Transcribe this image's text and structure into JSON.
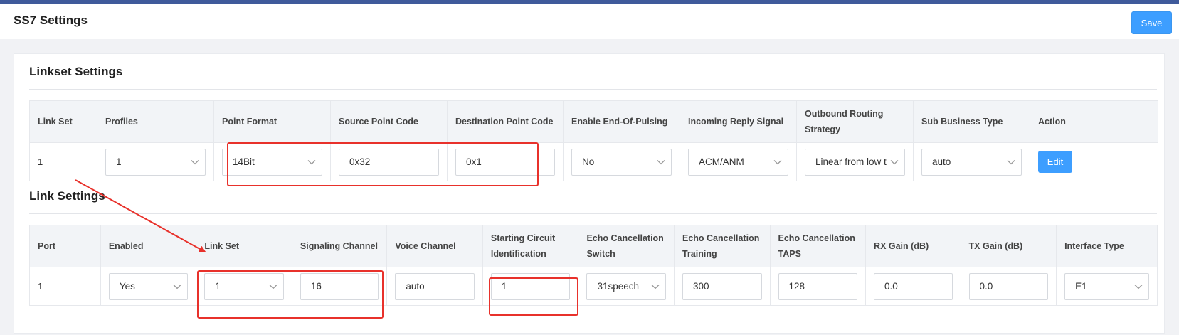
{
  "header": {
    "title": "SS7 Settings",
    "save_label": "Save"
  },
  "linkset": {
    "title": "Linkset Settings",
    "columns": [
      "Link Set",
      "Profiles",
      "Point Format",
      "Source Point Code",
      "Destination Point Code",
      "Enable End-Of-Pulsing",
      "Incoming Reply Signal",
      "Outbound Routing Strategy",
      "Sub Business Type",
      "Action"
    ],
    "row": {
      "link_set": "1",
      "profiles": "1",
      "point_format": "14Bit",
      "source_point_code": "0x32",
      "destination_point_code": "0x1",
      "enable_eop": "No",
      "incoming_reply_signal": "ACM/ANM",
      "outbound_routing_strategy": "Linear from low to",
      "sub_business_type": "auto",
      "edit_label": "Edit"
    }
  },
  "link": {
    "title": "Link Settings",
    "columns": [
      "Port",
      "Enabled",
      "Link Set",
      "Signaling Channel",
      "Voice Channel",
      "Starting Circuit Identification",
      "Echo Cancellation Switch",
      "Echo Cancellation Training",
      "Echo Cancellation TAPS",
      "RX Gain (dB)",
      "TX Gain (dB)",
      "Interface Type"
    ],
    "row": {
      "port": "1",
      "enabled": "Yes",
      "link_set": "1",
      "signaling_channel": "16",
      "voice_channel": "auto",
      "starting_cic": "1",
      "echo_switch": "31speech",
      "echo_training": "300",
      "echo_taps": "128",
      "rx_gain": "0.0",
      "tx_gain": "0.0",
      "interface_type": "E1"
    }
  },
  "colors": {
    "accent": "#3d9eff",
    "highlight": "#e8312b",
    "topbar": "#3f5a9b"
  }
}
